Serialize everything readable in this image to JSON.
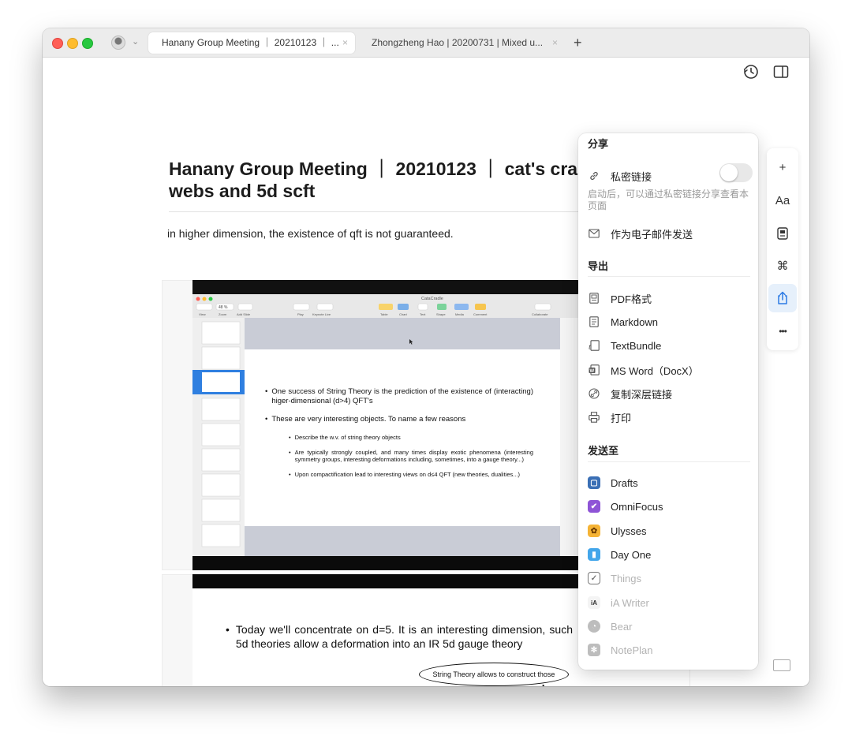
{
  "colors": {
    "close": "#ff5f57",
    "minimize": "#febc2e",
    "zoom": "#28c840",
    "accent": "#2c7be5"
  },
  "tabs": [
    {
      "label": "Hanany Group Meeting ｜ 20210123 ｜ ...",
      "close": "×"
    },
    {
      "label": "Zhongzheng Hao | 20200731 | Mixed u...",
      "close": "×"
    }
  ],
  "new_tab": "+",
  "document": {
    "title": "Hanany Group Meeting ｜ 20210123 ｜ cat's cra\nwebs and 5d scft",
    "paragraph": "in higher dimension, the existence of qft is not guaranteed.",
    "slide1": {
      "app_title": "CataCradle",
      "toolbar": [
        "View",
        "Zoom",
        "Add Slide",
        "Play",
        "Keynote Live",
        "Table",
        "Chart",
        "Text",
        "Shape",
        "Media",
        "Comment",
        "Collaborate"
      ],
      "zoom_value": "48 %",
      "bullets": [
        "One success of String Theory is the prediction of the existence of (interacting) higer-dimensional (d>4) QFT's",
        "These are very interesting objects. To name a few reasons"
      ],
      "sub_bullets": [
        "Describe the w.v. of string theory objects",
        "Are typically strongly coupled, and many times display exotic phenomena (interesting symmetry groups, interesting deformations including, sometimes, into a gauge theory...)",
        "Upon compactification lead to interesting views on d≤4 QFT (new theories, dualities...)"
      ]
    },
    "slide2": {
      "bullet": "Today we'll concentrate on d=5. It is an interesting dimension, such 5d theories allow a deformation into an IR 5d gauge theory",
      "callout": "String Theory allows to construct those"
    }
  },
  "share_panel": {
    "share_header": "分享",
    "private_link": "私密链接",
    "private_link_hint": "启动后，可以通过私密链接分享查看本页面",
    "email": "作为电子邮件发送",
    "export_header": "导出",
    "export_items": [
      {
        "label": "PDF格式",
        "icon": "pdf-icon"
      },
      {
        "label": "Markdown",
        "icon": "markdown-icon"
      },
      {
        "label": "TextBundle",
        "icon": "textbundle-icon"
      },
      {
        "label": "MS Word（DocX）",
        "icon": "word-icon"
      },
      {
        "label": "复制深层链接",
        "icon": "deep-link-icon"
      },
      {
        "label": "打印",
        "icon": "print-icon"
      }
    ],
    "send_header": "发送至",
    "send_items": [
      {
        "label": "Drafts",
        "color": "#3a6fb5",
        "enabled": true
      },
      {
        "label": "OmniFocus",
        "color": "#8e54d6",
        "enabled": true
      },
      {
        "label": "Ulysses",
        "color": "#f5b335",
        "enabled": true
      },
      {
        "label": "Day One",
        "color": "#43a6ea",
        "enabled": true
      },
      {
        "label": "Things",
        "color": "#9a9a9a",
        "enabled": false
      },
      {
        "label": "iA Writer",
        "color": "#bdbdbd",
        "enabled": false
      },
      {
        "label": "Bear",
        "color": "#bdbdbd",
        "enabled": false
      },
      {
        "label": "NotePlan",
        "color": "#bdbdbd",
        "enabled": false
      }
    ]
  },
  "rail": {
    "buttons": [
      {
        "glyph": "+",
        "name": "add-button"
      },
      {
        "glyph": "Aa",
        "name": "format-button"
      },
      {
        "glyph": "▤",
        "name": "info-button"
      },
      {
        "glyph": "⌘",
        "name": "shortcuts-button"
      },
      {
        "glyph": "⇪",
        "name": "share-button"
      },
      {
        "glyph": "•••",
        "name": "more-button"
      }
    ],
    "selected": "share-button"
  }
}
